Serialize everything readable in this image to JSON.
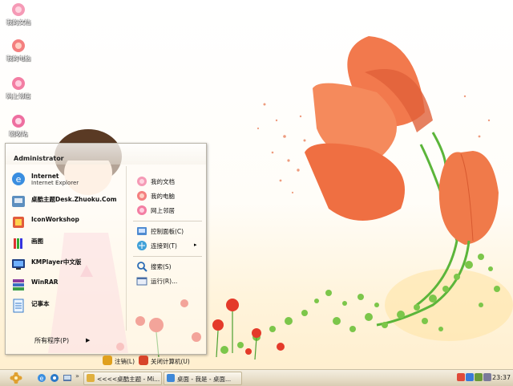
{
  "desktop": {
    "icons": [
      {
        "label": "我的文档",
        "icon": "flower-folder-icon"
      },
      {
        "label": "我的电脑",
        "icon": "flower-computer-icon"
      },
      {
        "label": "网上邻居",
        "icon": "flower-network-icon"
      },
      {
        "label": "回收站",
        "icon": "flower-recycle-icon"
      }
    ]
  },
  "start_menu": {
    "user": "Administrator",
    "programs": [
      {
        "name": "Internet",
        "sub": "Internet Explorer",
        "icon": "internet-explorer-icon"
      },
      {
        "name": "桌酷主题Desk.Zhuoku.Com",
        "sub": "",
        "icon": "zhuoku-theme-icon"
      },
      {
        "name": "IconWorkshop",
        "sub": "",
        "icon": "iconworkshop-icon"
      },
      {
        "name": "画图",
        "sub": "",
        "icon": "paint-icon"
      },
      {
        "name": "KMPlayer中文版",
        "sub": "",
        "icon": "kmplayer-icon"
      },
      {
        "name": "WinRAR",
        "sub": "",
        "icon": "winrar-icon"
      },
      {
        "name": "记事本",
        "sub": "",
        "icon": "notepad-icon"
      }
    ],
    "all_programs": "所有程序(P)",
    "places": [
      {
        "name": "我的文档",
        "icon": "flower-folder-icon"
      },
      {
        "name": "我的电脑",
        "icon": "flower-computer-icon"
      },
      {
        "name": "网上邻居",
        "icon": "flower-network-icon"
      }
    ],
    "system": [
      {
        "name": "控制面板(C)",
        "icon": "control-panel-icon"
      },
      {
        "name": "连接到(T)",
        "icon": "connect-to-icon",
        "arrow": "▸"
      },
      {
        "name": "搜索(S)",
        "icon": "search-icon"
      },
      {
        "name": "运行(R)...",
        "icon": "run-icon"
      }
    ],
    "footer": {
      "logoff": "注销(L)",
      "shutdown": "关闭计算机(U)"
    }
  },
  "taskbar": {
    "quick_launch": [
      "internet-explorer-icon",
      "chrome-icon",
      "show-desktop-icon"
    ],
    "tasks": [
      {
        "label": "<<<<桌酷主题 - Mi...",
        "icon": "folder-icon"
      },
      {
        "label": "桌面 - 我是 - 桌面...",
        "icon": "chrome-icon"
      }
    ],
    "clock": "23:37",
    "colors": {
      "accent": "#ff6a3d",
      "taskbar": "#e6dcc6"
    }
  }
}
